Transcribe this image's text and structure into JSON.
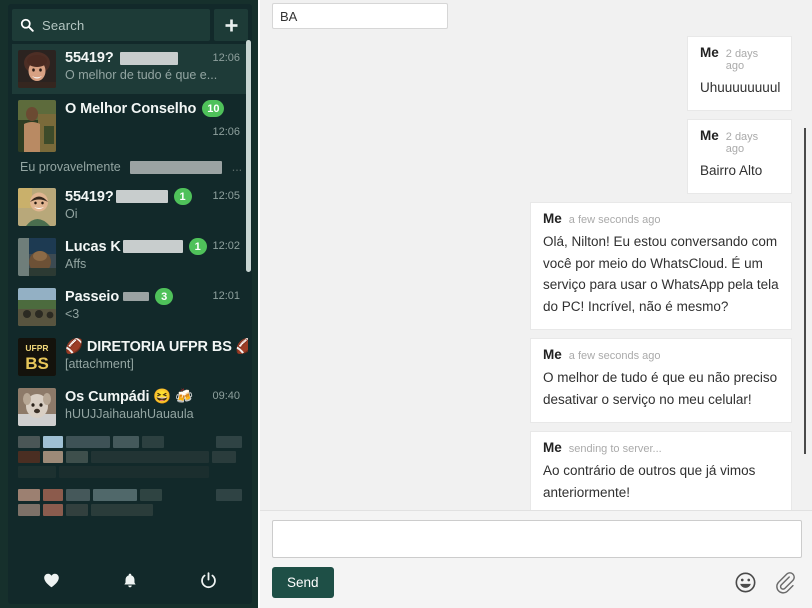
{
  "sidebar": {
    "search": {
      "placeholder": "Search",
      "icon": "search-icon"
    },
    "add_button": {
      "label": "+",
      "icon": "plus-icon"
    },
    "chats": [
      {
        "name": "55419?",
        "name_redacted": true,
        "preview": "O melhor de tudo é que e...",
        "time": "12:06",
        "badge": "",
        "selected": true,
        "time_position": "top"
      },
      {
        "name": "O Melhor Conselho",
        "name_redacted": false,
        "preview": "Eu provavelmente",
        "preview_redacted": true,
        "preview_suffix": "...",
        "time": "12:06",
        "badge": "10",
        "selected": false,
        "time_position": "low"
      },
      {
        "name": "55419?",
        "name_redacted": true,
        "preview": "Oi",
        "time": "12:05",
        "badge": "1",
        "selected": false,
        "time_position": "top"
      },
      {
        "name": "Lucas K",
        "name_redacted": true,
        "preview": "Affs",
        "time": "12:02",
        "badge": "1",
        "selected": false,
        "time_position": "top"
      },
      {
        "name": "Passeio",
        "name_redacted": true,
        "preview": "<3",
        "time": "12:01",
        "badge": "3",
        "selected": false,
        "time_position": "top"
      },
      {
        "name": "🏈 DIRETORIA UFPR BS 🏈",
        "name_redacted": false,
        "preview": "[attachment]",
        "time": "",
        "badge": "",
        "selected": false,
        "time_position": "top"
      },
      {
        "name": "Os Cumpádi 😆 🍻",
        "name_redacted": false,
        "preview": "hUUJJaihauahUauaula",
        "time": "09:40",
        "badge": "",
        "selected": false,
        "time_position": "top"
      }
    ],
    "footer_icons": [
      "heart-icon",
      "bell-icon",
      "power-icon"
    ]
  },
  "main": {
    "recipient": {
      "value": "BA",
      "placeholder": ""
    },
    "messages": [
      {
        "author": "Me",
        "time": "2 days ago",
        "text": "Uhuuuuuuuul",
        "side": "right"
      },
      {
        "author": "Me",
        "time": "2 days ago",
        "text": "Bairro Alto",
        "side": "right"
      },
      {
        "author": "Me",
        "time": "a few seconds ago",
        "text": "Olá, Nilton! Eu estou conversando com você por meio do WhatsCloud. É um serviço para usar o WhatsApp pela tela do PC! Incrível, não é mesmo?",
        "side": "left"
      },
      {
        "author": "Me",
        "time": "a few seconds ago",
        "text": "O melhor de tudo é que eu não preciso desativar o serviço no meu celular!",
        "side": "left"
      },
      {
        "author": "Me",
        "time": "sending to server...",
        "text": "Ao contrário de outros que já vimos anteriormente!",
        "side": "left"
      }
    ],
    "composer": {
      "input_value": "",
      "input_placeholder": "",
      "send_label": "Send",
      "tools": [
        "emoji-icon",
        "attachment-icon"
      ]
    }
  },
  "colors": {
    "sidebar_bg": "#16302c",
    "sidebar_panel": "#12292a",
    "selected_item": "#1e3b38",
    "badge_green": "#4fc15a",
    "send_button": "#1e4f46",
    "main_bg": "#f1f1f1",
    "bubble_bg": "#ffffff"
  }
}
